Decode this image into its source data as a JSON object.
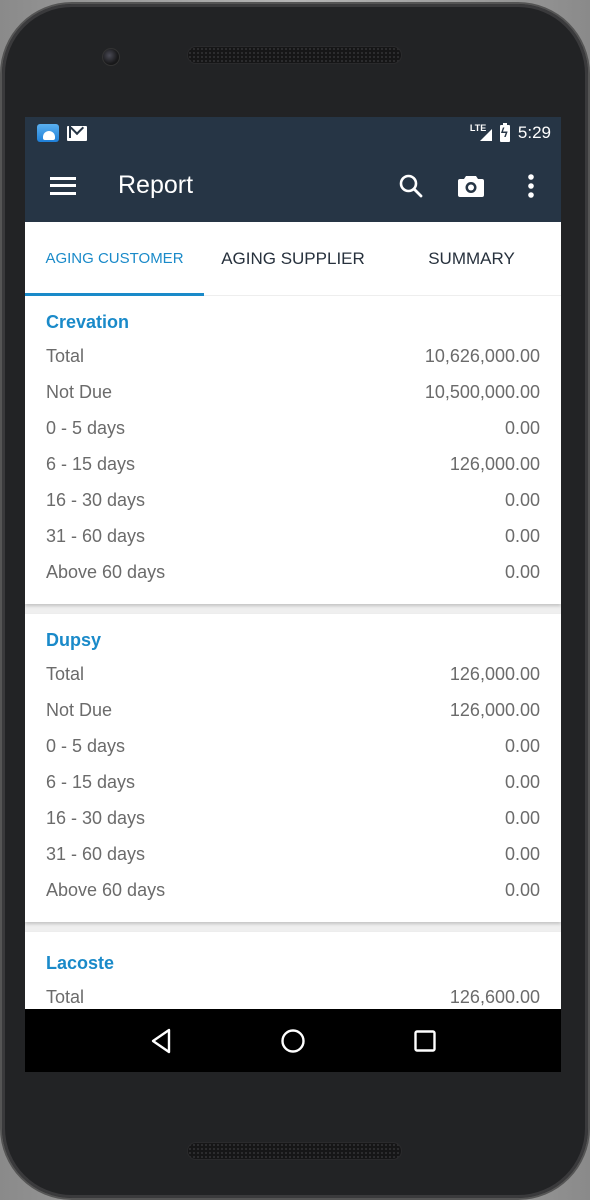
{
  "status_bar": {
    "notification_icons": [
      "es-file-explorer-icon",
      "gmail-icon"
    ],
    "network": "LTE",
    "time": "5:29"
  },
  "toolbar": {
    "title": "Report",
    "actions": [
      "search-icon",
      "camera-icon",
      "overflow-menu-icon"
    ]
  },
  "tabs": [
    {
      "label": "AGING CUSTOMER",
      "active": true
    },
    {
      "label": "AGING SUPPLIER",
      "active": false
    },
    {
      "label": "SUMMARY",
      "active": false
    }
  ],
  "colors": {
    "app_bar": "#263545",
    "accent": "#1a8ac9",
    "text_secondary": "#6b6b6b"
  },
  "reports": [
    {
      "name": "Crevation",
      "rows": [
        {
          "label": "Total",
          "value": "10,626,000.00"
        },
        {
          "label": "Not Due",
          "value": "10,500,000.00"
        },
        {
          "label": "0 - 5 days",
          "value": "0.00"
        },
        {
          "label": "6 - 15 days",
          "value": "126,000.00"
        },
        {
          "label": "16 - 30 days",
          "value": "0.00"
        },
        {
          "label": "31 - 60 days",
          "value": "0.00"
        },
        {
          "label": "Above 60 days",
          "value": "0.00"
        }
      ]
    },
    {
      "name": "Dupsy",
      "rows": [
        {
          "label": "Total",
          "value": "126,000.00"
        },
        {
          "label": "Not Due",
          "value": "126,000.00"
        },
        {
          "label": "0 - 5 days",
          "value": "0.00"
        },
        {
          "label": "6 - 15 days",
          "value": "0.00"
        },
        {
          "label": "16 - 30 days",
          "value": "0.00"
        },
        {
          "label": "31 - 60 days",
          "value": "0.00"
        },
        {
          "label": "Above 60 days",
          "value": "0.00"
        }
      ]
    },
    {
      "name": "Lacoste",
      "rows": [
        {
          "label": "Total",
          "value": "126,600.00"
        }
      ]
    }
  ],
  "nav_bar": [
    "back-icon",
    "home-icon",
    "recents-icon"
  ]
}
